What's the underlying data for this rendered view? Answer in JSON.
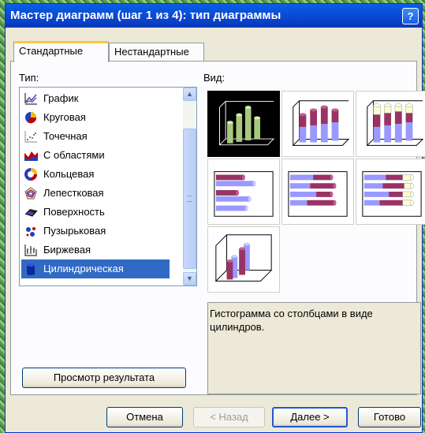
{
  "dialog": {
    "title": "Мастер диаграмм (шаг 1 из 4): тип диаграммы",
    "help_label": "?"
  },
  "tabs": [
    {
      "label": "Стандартные",
      "active": true
    },
    {
      "label": "Нестандартные",
      "active": false
    }
  ],
  "type_section": {
    "label": "Тип:",
    "items": [
      {
        "label": "График",
        "icon": "line-chart-icon"
      },
      {
        "label": "Круговая",
        "icon": "pie-chart-icon"
      },
      {
        "label": "Точечная",
        "icon": "scatter-chart-icon"
      },
      {
        "label": "С областями",
        "icon": "area-chart-icon"
      },
      {
        "label": "Кольцевая",
        "icon": "donut-chart-icon"
      },
      {
        "label": "Лепестковая",
        "icon": "radar-chart-icon"
      },
      {
        "label": "Поверхность",
        "icon": "surface-chart-icon"
      },
      {
        "label": "Пузырьковая",
        "icon": "bubble-chart-icon"
      },
      {
        "label": "Биржевая",
        "icon": "stock-chart-icon"
      },
      {
        "label": "Цилиндрическая",
        "icon": "cylinder-chart-icon",
        "selected": true
      }
    ]
  },
  "view_section": {
    "label": "Вид:",
    "selected_index": 0,
    "count": 7
  },
  "description": "Гистограмма со столбцами в виде цилиндров.",
  "preview_button": "Просмотр результата",
  "buttons": {
    "cancel": "Отмена",
    "back": "< Назад",
    "next": "Далее >",
    "finish": "Готово"
  },
  "colors": {
    "title_bar": "#0a52dd",
    "selection": "#316ac5",
    "cylinder_purple": "#993366",
    "cylinder_lavender": "#9999ff",
    "cylinder_yellow": "#ffffcc",
    "cylinder_selected_green": "#a7c97e"
  }
}
